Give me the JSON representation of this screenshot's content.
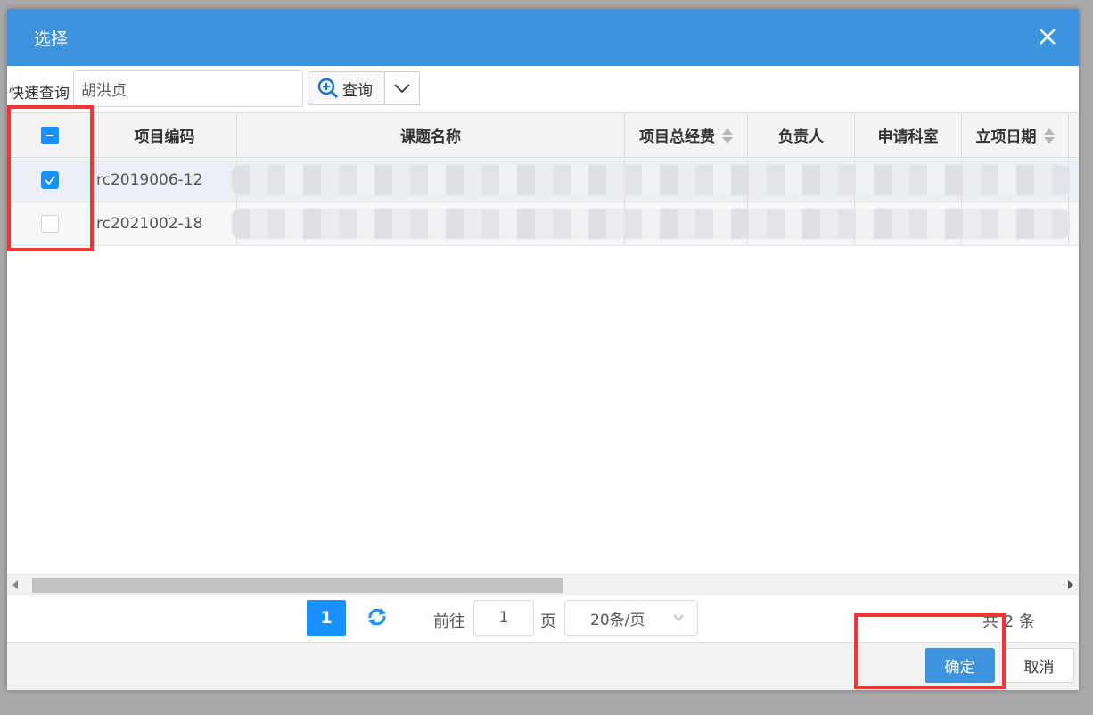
{
  "dialog": {
    "title": "选择",
    "close_icon": "close-icon"
  },
  "toolbar": {
    "quick_search_label": "快速查询",
    "search_value": "胡洪贞",
    "search_button_label": "查询",
    "search_icon": "magnifier-plus-icon",
    "dropdown_icon": "chevron-down-icon"
  },
  "table": {
    "columns": [
      "项目编码",
      "课题名称",
      "项目总经费",
      "负责人",
      "申请科室",
      "立项日期"
    ],
    "sortable_columns": [
      "项目总经费",
      "立项日期"
    ],
    "rows": [
      {
        "checked": true,
        "code": "rc2019006-12"
      },
      {
        "checked": false,
        "code": "rc2021002-18"
      }
    ],
    "header_checkbox_state": "indeterminate"
  },
  "pager": {
    "current_page": "1",
    "goto_label": "前往",
    "goto_value": "1",
    "page_unit": "页",
    "page_size": "20条/页",
    "total": "共 2 条"
  },
  "footer": {
    "ok_label": "确定",
    "cancel_label": "取消"
  },
  "colors": {
    "header_blue": "#3d93dc",
    "accent": "#1890ff",
    "highlight_red": "#f03535"
  }
}
